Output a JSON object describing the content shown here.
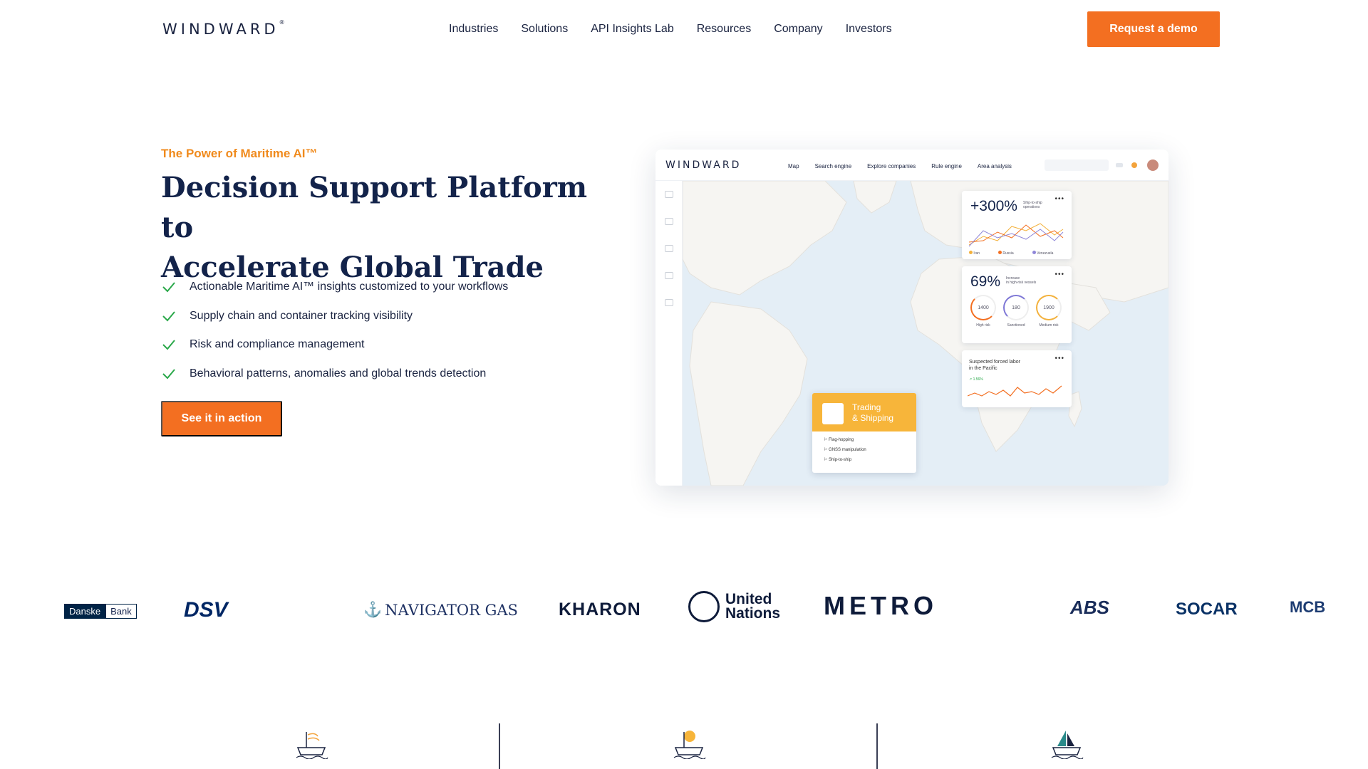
{
  "header": {
    "logo": "WINDWARD",
    "logo_mark": "®",
    "nav": [
      "Industries",
      "Solutions",
      "API Insights Lab",
      "Resources",
      "Company",
      "Investors"
    ],
    "cta": "Request a demo"
  },
  "hero": {
    "eyebrow": "The Power of Maritime AI™",
    "title_line1": "Decision Support Platform to",
    "title_line2": "Accelerate Global Trade",
    "features": [
      "Actionable Maritime AI™ insights customized to your workflows",
      "Supply chain and container tracking visibility",
      "Risk and compliance management",
      "Behavioral patterns, anomalies and global trends detection"
    ],
    "cta": "See it in action"
  },
  "dashboard": {
    "logo": "WINDWARD",
    "nav": [
      "Map",
      "Search engine",
      "Explore companies",
      "Rule engine",
      "Area analysis"
    ],
    "card1": {
      "value": "+300%",
      "label_line1": "Ship-to-ship",
      "label_line2": "operations",
      "legend": [
        "Iran",
        "Russia",
        "Venezuela"
      ],
      "legend_colors": [
        "#f3b13c",
        "#f36f21",
        "#8f86d8"
      ]
    },
    "card2": {
      "value": "69%",
      "label_line1": "Increase",
      "label_line2": "in high-risk vessels",
      "gauges": [
        {
          "value": "1400",
          "label": "High risk",
          "color": "#f36f21"
        },
        {
          "value": "180",
          "label": "Sanctioned",
          "color": "#7f78d6"
        },
        {
          "value": "1900",
          "label": "Medium risk",
          "color": "#f3b13c"
        }
      ]
    },
    "card3": {
      "label_line1": "Suspected forced labor",
      "label_line2": "in the Pacific",
      "trend": "1.56%"
    },
    "popup": {
      "title_line1": "Trading",
      "title_line2": "& Shipping",
      "items": [
        "Flag-hopping",
        "GNSS manipulation",
        "Ship-to-ship"
      ]
    },
    "card_menu": "•••"
  },
  "logos": [
    {
      "name": "danske-bank-logo",
      "text1": "Danske",
      "text2": "Bank"
    },
    {
      "name": "dsv-logo",
      "text": "DSV"
    },
    {
      "name": "navigator-gas-logo",
      "text": "NAVIGATOR GAS"
    },
    {
      "name": "kharon-logo",
      "text": "KHARON"
    },
    {
      "name": "united-nations-logo",
      "text1": "United",
      "text2": "Nations"
    },
    {
      "name": "metro-logo",
      "text": "METRO"
    },
    {
      "name": "abs-logo",
      "text": "ABS"
    },
    {
      "name": "socar-logo",
      "text": "SOCAR"
    },
    {
      "name": "mcb-logo",
      "text": "MCB"
    }
  ],
  "colors": {
    "accent": "#f36f21",
    "eyebrow": "#f08a1c",
    "heading": "#13234a",
    "check": "#2aa84a"
  }
}
